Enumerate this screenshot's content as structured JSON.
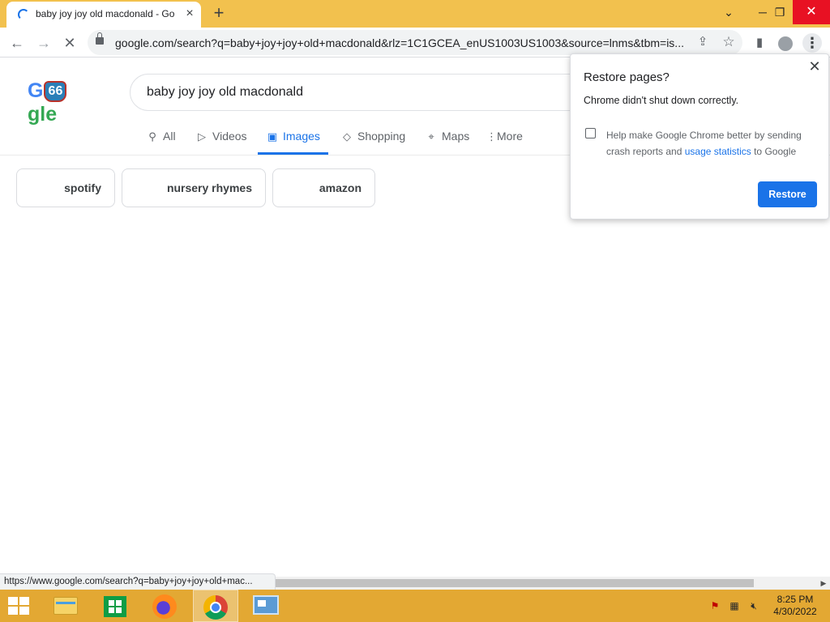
{
  "browser": {
    "tab_title": "baby joy joy old macdonald - Go",
    "new_tab_symbol": "+",
    "url": "google.com/search?q=baby+joy+joy+old+macdonald&rlz=1C1GCEA_enUS1003US1003&source=lnms&tbm=is...",
    "status_url": "https://www.google.com/search?q=baby+joy+joy+old+mac..."
  },
  "google": {
    "logo_left": "G",
    "logo_badge": "66",
    "logo_right": "gle",
    "search_query": "baby joy joy old macdonald",
    "tabs": [
      {
        "label": "All",
        "icon": "search-icon"
      },
      {
        "label": "Videos",
        "icon": "play-icon"
      },
      {
        "label": "Images",
        "icon": "image-icon",
        "active": true
      },
      {
        "label": "Shopping",
        "icon": "tag-icon"
      },
      {
        "label": "Maps",
        "icon": "map-pin-icon"
      },
      {
        "label": "More",
        "icon": "more-vertical-icon"
      }
    ],
    "chips": [
      "spotify",
      "nursery rhymes",
      "amazon"
    ]
  },
  "restore_dialog": {
    "title": "Restore pages?",
    "message": "Chrome didn't shut down correctly.",
    "checkbox_text_before": "Help make Google Chrome better by sending crash reports and ",
    "checkbox_link": "usage statistics",
    "checkbox_text_after": " to Google",
    "checkbox_checked": false,
    "restore_label": "Restore"
  },
  "taskbar": {
    "time": "8:25 PM",
    "date": "4/30/2022",
    "apps": [
      "start-button",
      "file-explorer",
      "store",
      "firefox",
      "chrome",
      "remote-desktop"
    ],
    "active_app": "chrome"
  },
  "colors": {
    "titlebar": "#f2c14e",
    "taskbar": "#e3a833",
    "accent": "#1a73e8",
    "close_button": "#e81123"
  }
}
